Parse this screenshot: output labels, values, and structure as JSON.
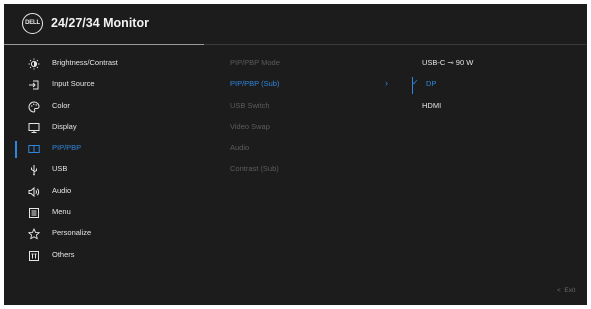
{
  "header": {
    "logo_text": "DELL",
    "title": "24/27/34 Monitor"
  },
  "menu": {
    "items": [
      {
        "label": "Brightness/Contrast",
        "icon": "brightness-icon"
      },
      {
        "label": "Input Source",
        "icon": "input-source-icon"
      },
      {
        "label": "Color",
        "icon": "color-palette-icon"
      },
      {
        "label": "Display",
        "icon": "display-icon"
      },
      {
        "label": "PIP/PBP",
        "icon": "pip-pbp-icon",
        "active": true
      },
      {
        "label": "USB",
        "icon": "usb-icon"
      },
      {
        "label": "Audio",
        "icon": "speaker-icon"
      },
      {
        "label": "Menu",
        "icon": "menu-icon"
      },
      {
        "label": "Personalize",
        "icon": "star-icon"
      },
      {
        "label": "Others",
        "icon": "others-icon"
      }
    ]
  },
  "submenu": {
    "items": [
      {
        "label": "PIP/PBP Mode"
      },
      {
        "label": "PIP/PBP (Sub)",
        "active": true
      },
      {
        "label": "USB Switch"
      },
      {
        "label": "Video Swap"
      },
      {
        "label": "Audio"
      },
      {
        "label": "Contrast (Sub)"
      }
    ]
  },
  "options": {
    "items": [
      {
        "label": "USB-C ⊸ 90 W",
        "selected": false
      },
      {
        "label": "DP",
        "selected": true
      },
      {
        "label": "HDMI",
        "selected": false
      }
    ],
    "check_glyph": "✓"
  },
  "footer": {
    "exit_label": "Exit",
    "exit_glyph": "<"
  },
  "colors": {
    "background": "#1c1c1c",
    "accent": "#2f86dd",
    "text": "#e6e6e6",
    "disabled_text": "#5c5c5c"
  }
}
